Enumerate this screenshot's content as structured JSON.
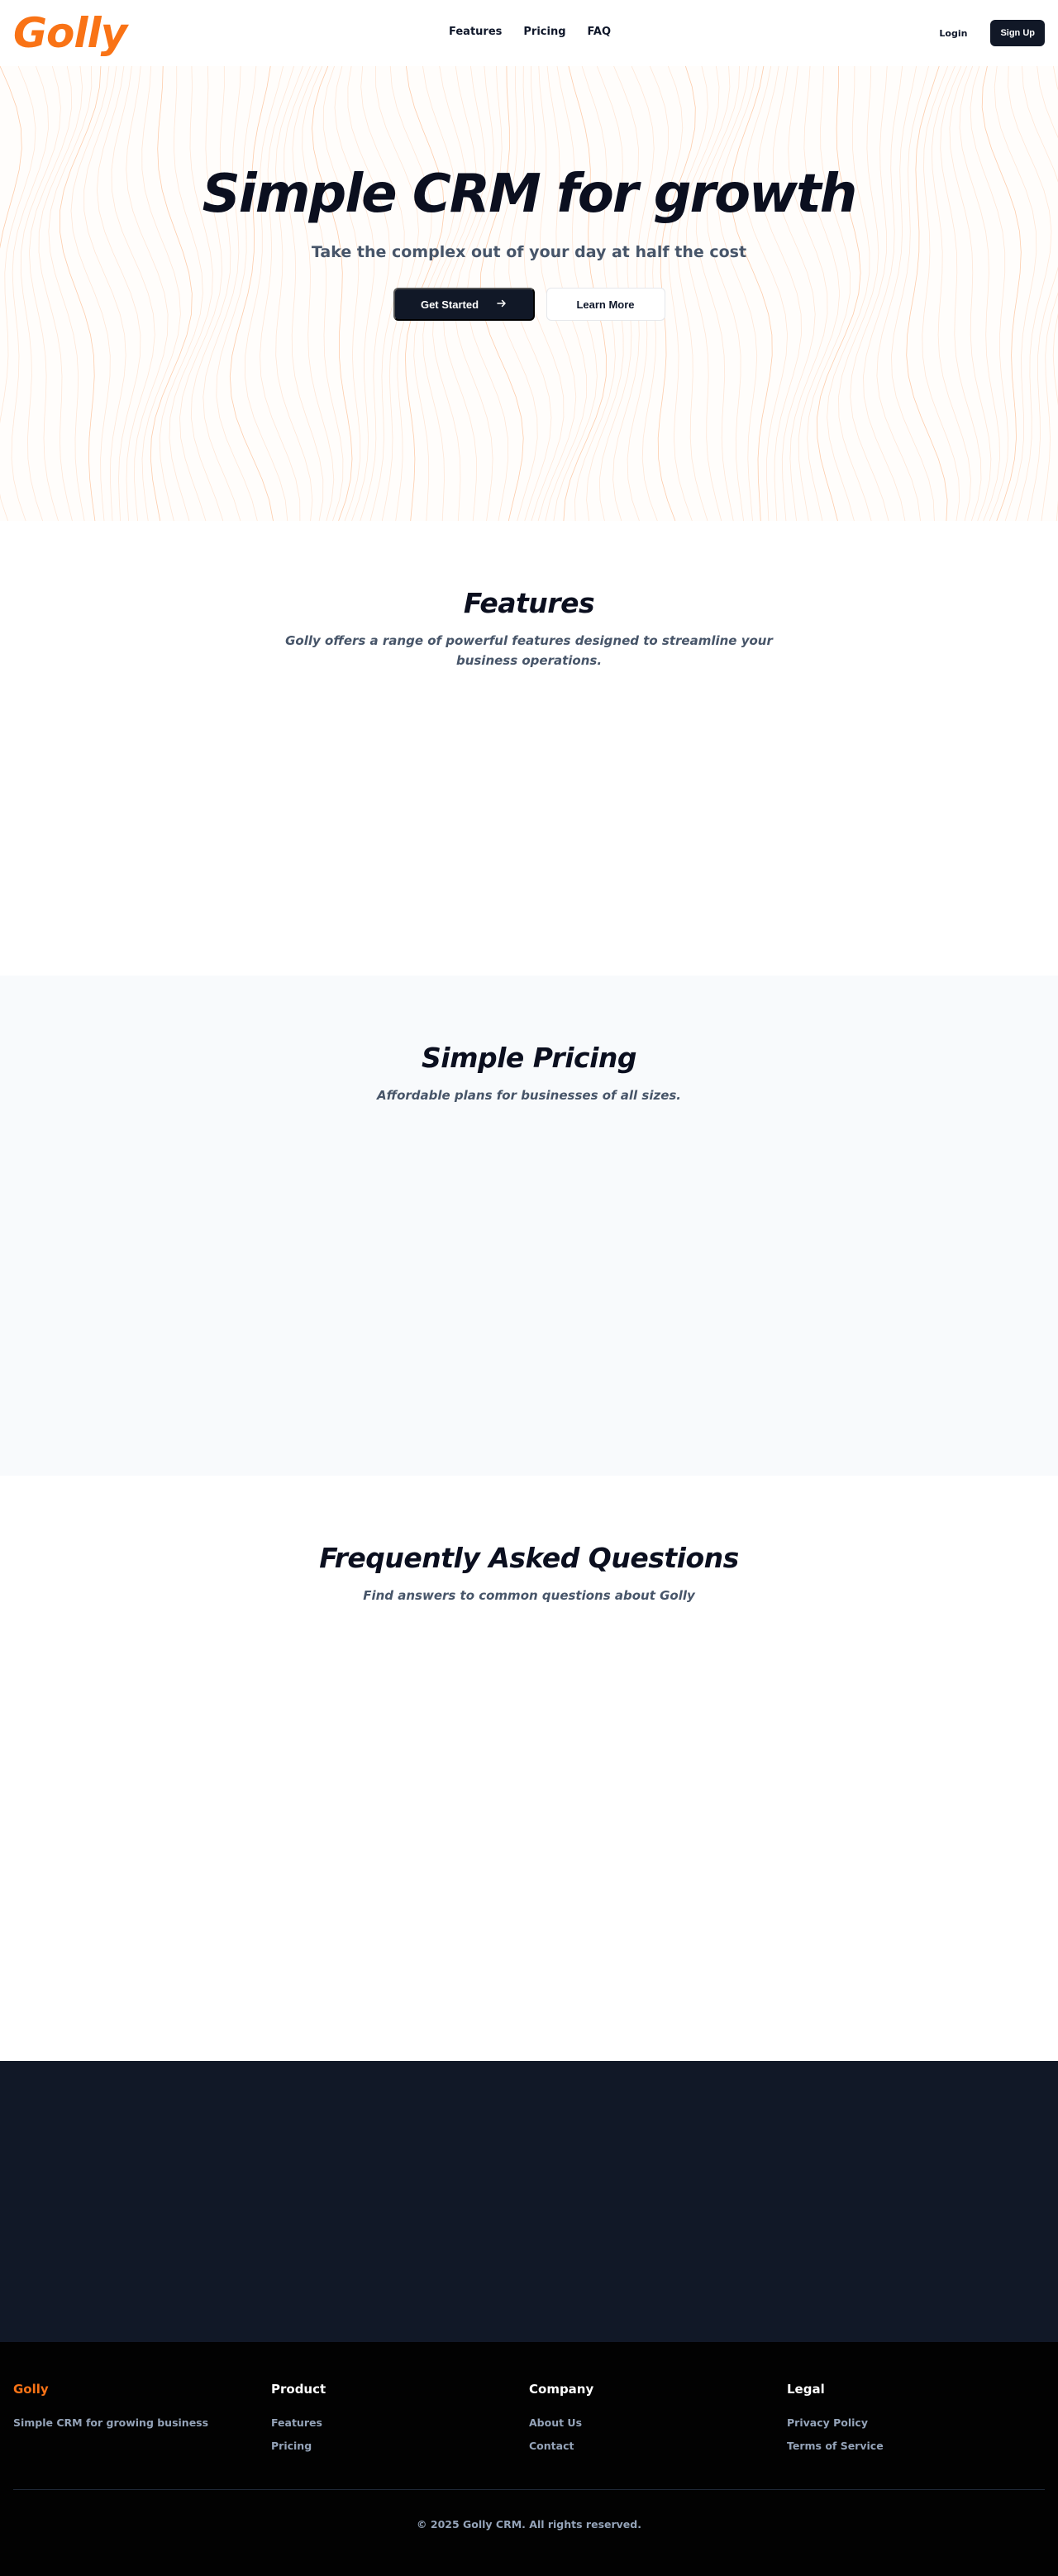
{
  "header": {
    "logo": "Golly",
    "nav": [
      "Features",
      "Pricing",
      "FAQ"
    ],
    "login": "Login",
    "signup": "Sign Up"
  },
  "hero": {
    "title": "Simple CRM for growth",
    "subtitle": "Take the complex out of your day at half the cost",
    "primary_button": "Get Started",
    "primary_icon": "arrow-right-icon",
    "secondary_button": "Learn More"
  },
  "features": {
    "title": "Features",
    "subtitle": "Golly offers a range of powerful features designed to streamline your business operations."
  },
  "pricing": {
    "title": "Simple Pricing",
    "subtitle": "Affordable plans for businesses of all sizes."
  },
  "faq": {
    "title": "Frequently Asked Questions",
    "subtitle": "Find answers to common questions about Golly"
  },
  "footer": {
    "brand": {
      "title": "Golly",
      "tagline": "Simple CRM for growing business"
    },
    "product": {
      "title": "Product",
      "links": [
        "Features",
        "Pricing"
      ]
    },
    "company": {
      "title": "Company",
      "links": [
        "About Us",
        "Contact"
      ]
    },
    "legal": {
      "title": "Legal",
      "links": [
        "Privacy Policy",
        "Terms of Service"
      ]
    },
    "copyright": "© 2025 Golly CRM. All rights reserved."
  },
  "colors": {
    "brand": "#f97316",
    "dark": "#111827",
    "text_muted": "#475569",
    "pricing_bg": "#f8fafc",
    "footer_bg": "#020202"
  }
}
